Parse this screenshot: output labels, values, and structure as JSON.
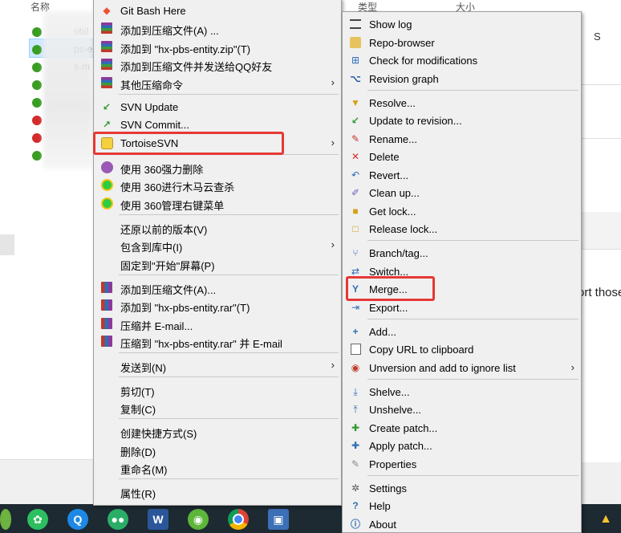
{
  "explorer": {
    "col_name": "名称",
    "col_type": "类型",
    "col_size": "大小",
    "col_s": "S",
    "files": [
      {
        "name": "obil",
        "status": "ok"
      },
      {
        "name": "ps-e",
        "status": "ok"
      },
      {
        "name": "s-m",
        "status": "ok"
      },
      {
        "name": "",
        "status": "ok"
      },
      {
        "name": "",
        "status": "ok"
      },
      {
        "name": "",
        "status": "err"
      },
      {
        "name": "",
        "status": "err"
      },
      {
        "name": "",
        "status": "ok"
      }
    ],
    "right_snippet": "ort those"
  },
  "main_menu": {
    "items": [
      {
        "label": "Git Bash Here",
        "icon": "git-bash-icon"
      },
      {
        "label": "添加到压缩文件(A) ...",
        "icon": "compress-icon"
      },
      {
        "label": "添加到 \"hx-pbs-entity.zip\"(T)",
        "icon": "compress-icon"
      },
      {
        "label": "添加到压缩文件并发送给QQ好友",
        "icon": "compress-icon"
      },
      {
        "label": "其他压缩命令",
        "icon": "compress-icon",
        "submenu": true
      },
      {
        "label": "SVN Update",
        "icon": "svn-update-icon"
      },
      {
        "label": "SVN Commit...",
        "icon": "svn-commit-icon"
      },
      {
        "label": "TortoiseSVN",
        "icon": "tortoisesvn-icon",
        "submenu": true
      },
      {
        "label": "使用 360强力删除",
        "icon": "360-delete-icon"
      },
      {
        "label": "使用 360进行木马云查杀",
        "icon": "360-scan-icon"
      },
      {
        "label": "使用 360管理右键菜单",
        "icon": "360-manage-icon"
      },
      {
        "label": "还原以前的版本(V)"
      },
      {
        "label": "包含到库中(I)",
        "submenu": true
      },
      {
        "label": "固定到\"开始\"屏幕(P)"
      },
      {
        "label": "添加到压缩文件(A)...",
        "icon": "winrar-icon"
      },
      {
        "label": "添加到 \"hx-pbs-entity.rar\"(T)",
        "icon": "winrar-icon"
      },
      {
        "label": "压缩并 E-mail...",
        "icon": "winrar-icon"
      },
      {
        "label": "压缩到 \"hx-pbs-entity.rar\" 并 E-mail",
        "icon": "winrar-icon"
      },
      {
        "label": "发送到(N)",
        "submenu": true
      },
      {
        "label": "剪切(T)"
      },
      {
        "label": "复制(C)"
      },
      {
        "label": "创建快捷方式(S)"
      },
      {
        "label": "删除(D)"
      },
      {
        "label": "重命名(M)"
      },
      {
        "label": "属性(R)"
      }
    ]
  },
  "svn_menu": {
    "items": [
      {
        "label": "Show log",
        "icon": "show-log-icon"
      },
      {
        "label": "Repo-browser",
        "icon": "repo-browser-icon"
      },
      {
        "label": "Check for modifications",
        "icon": "check-modifications-icon"
      },
      {
        "label": "Revision graph",
        "icon": "revision-graph-icon"
      },
      {
        "label": "Resolve...",
        "icon": "resolve-icon"
      },
      {
        "label": "Update to revision...",
        "icon": "update-revision-icon"
      },
      {
        "label": "Rename...",
        "icon": "rename-icon"
      },
      {
        "label": "Delete",
        "icon": "delete-icon"
      },
      {
        "label": "Revert...",
        "icon": "revert-icon"
      },
      {
        "label": "Clean up...",
        "icon": "clean-up-icon"
      },
      {
        "label": "Get lock...",
        "icon": "get-lock-icon"
      },
      {
        "label": "Release lock...",
        "icon": "release-lock-icon"
      },
      {
        "label": "Branch/tag...",
        "icon": "branch-tag-icon"
      },
      {
        "label": "Switch...",
        "icon": "switch-icon"
      },
      {
        "label": "Merge...",
        "icon": "merge-icon"
      },
      {
        "label": "Export...",
        "icon": "export-icon"
      },
      {
        "label": "Add...",
        "icon": "add-icon"
      },
      {
        "label": "Copy URL to clipboard",
        "icon": "copy-url-icon"
      },
      {
        "label": "Unversion and add to ignore list",
        "icon": "unversion-icon",
        "submenu": true
      },
      {
        "label": "Shelve...",
        "icon": "shelve-icon"
      },
      {
        "label": "Unshelve...",
        "icon": "unshelve-icon"
      },
      {
        "label": "Create patch...",
        "icon": "create-patch-icon"
      },
      {
        "label": "Apply patch...",
        "icon": "apply-patch-icon"
      },
      {
        "label": "Properties",
        "icon": "properties-icon"
      },
      {
        "label": "Settings",
        "icon": "settings-icon"
      },
      {
        "label": "Help",
        "icon": "help-icon"
      },
      {
        "label": "About",
        "icon": "about-icon"
      }
    ]
  },
  "taskbar": {
    "apps": [
      "spring-icon",
      "evernote-icon",
      "qq-browser-icon",
      "wechat-icon",
      "word-icon",
      "frog-icon",
      "chrome-icon",
      "remote-desktop-icon",
      "system-tray-icon"
    ],
    "word_letter": "W"
  },
  "colors": {
    "highlight": "#e53935",
    "menu_bg": "#f0f0f0",
    "taskbar_bg": "#1d2a32"
  }
}
